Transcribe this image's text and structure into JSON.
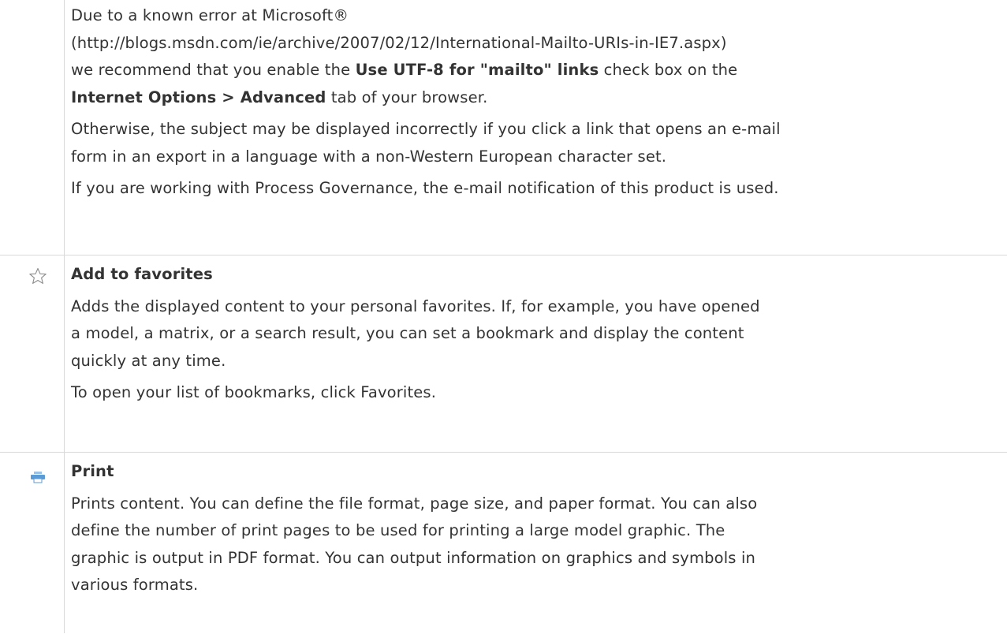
{
  "mailto": {
    "lines": [
      "Due to a known error at Microsoft®",
      "(http://blogs.msdn.com/ie/archive/2007/02/12/International-Mailto-URIs-in-IE7.aspx)"
    ],
    "line3_pre": "we recommend that you enable the ",
    "line3_bold": "Use UTF-8 for \"mailto\" links",
    "line3_post": " check box on the",
    "line4_bold": "Internet Options > Advanced",
    "line4_post": " tab of your browser.",
    "para2_line1": "Otherwise, the subject may be displayed incorrectly if you click a link that opens an e-mail",
    "para2_line2": "form in an export in a language with a non-Western European character set.",
    "para3": "If you are working with Process Governance, the e-mail notification of this product is used."
  },
  "favorites": {
    "icon": "star-icon",
    "title": "Add to favorites",
    "desc_line1": "Adds the displayed content to your personal favorites. If, for example, you have opened",
    "desc_line2": "a model, a matrix, or a search result, you can set a bookmark and display the content",
    "desc_line3": "quickly at any time.",
    "note": "To open your list of bookmarks, click Favorites."
  },
  "print": {
    "icon": "printer-icon",
    "title": "Print",
    "desc_line1": "Prints content. You can define the file format, page size, and paper format. You can also",
    "desc_line2": "define the number of print pages to be used for printing a large model graphic. The",
    "desc_line3": "graphic is output in PDF format. You can output information on graphics and symbols in",
    "desc_line4": "various formats."
  },
  "colors": {
    "text": "#333333",
    "border": "#d9d9d9",
    "print_icon": "#5b9bd5",
    "star_icon": "#8c8c8c"
  }
}
